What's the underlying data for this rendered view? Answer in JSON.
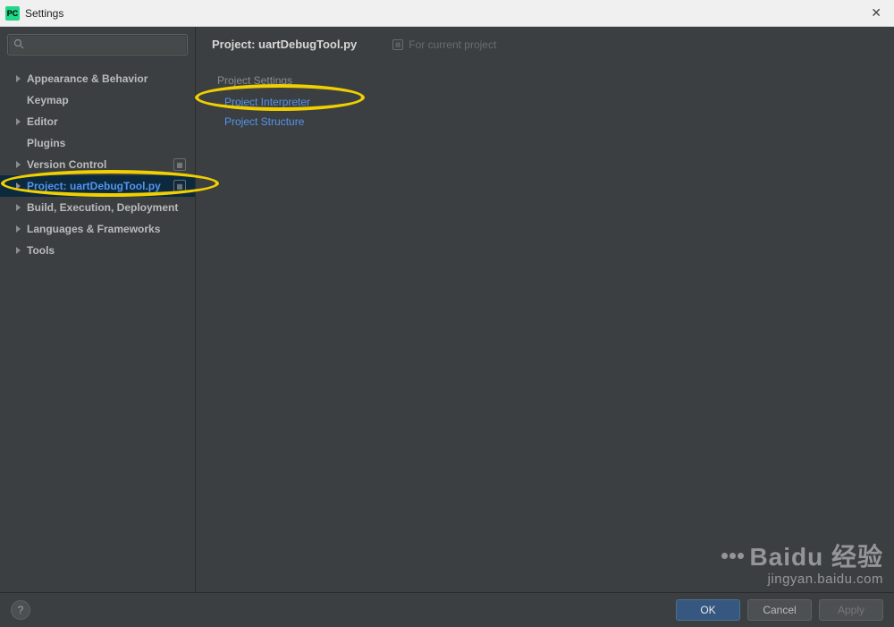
{
  "window": {
    "title": "Settings",
    "app_icon_text": "PC"
  },
  "search": {
    "placeholder": ""
  },
  "sidebar": {
    "items": [
      {
        "label": "Appearance & Behavior",
        "expandable": true
      },
      {
        "label": "Keymap",
        "expandable": false
      },
      {
        "label": "Editor",
        "expandable": true
      },
      {
        "label": "Plugins",
        "expandable": false
      },
      {
        "label": "Version Control",
        "expandable": true,
        "badge": true
      },
      {
        "label": "Project: uartDebugTool.py",
        "expandable": true,
        "badge": true,
        "selected": true
      },
      {
        "label": "Build, Execution, Deployment",
        "expandable": true
      },
      {
        "label": "Languages & Frameworks",
        "expandable": true
      },
      {
        "label": "Tools",
        "expandable": true
      }
    ]
  },
  "detail": {
    "title": "Project: uartDebugTool.py",
    "subnote": "For current project",
    "section_heading": "Project Settings",
    "links": [
      {
        "label": "Project Interpreter"
      },
      {
        "label": "Project Structure"
      }
    ]
  },
  "footer": {
    "help": "?",
    "ok": "OK",
    "cancel": "Cancel",
    "apply": "Apply"
  },
  "watermark": {
    "line1": "Baidu 经验",
    "line2": "jingyan.baidu.com"
  }
}
